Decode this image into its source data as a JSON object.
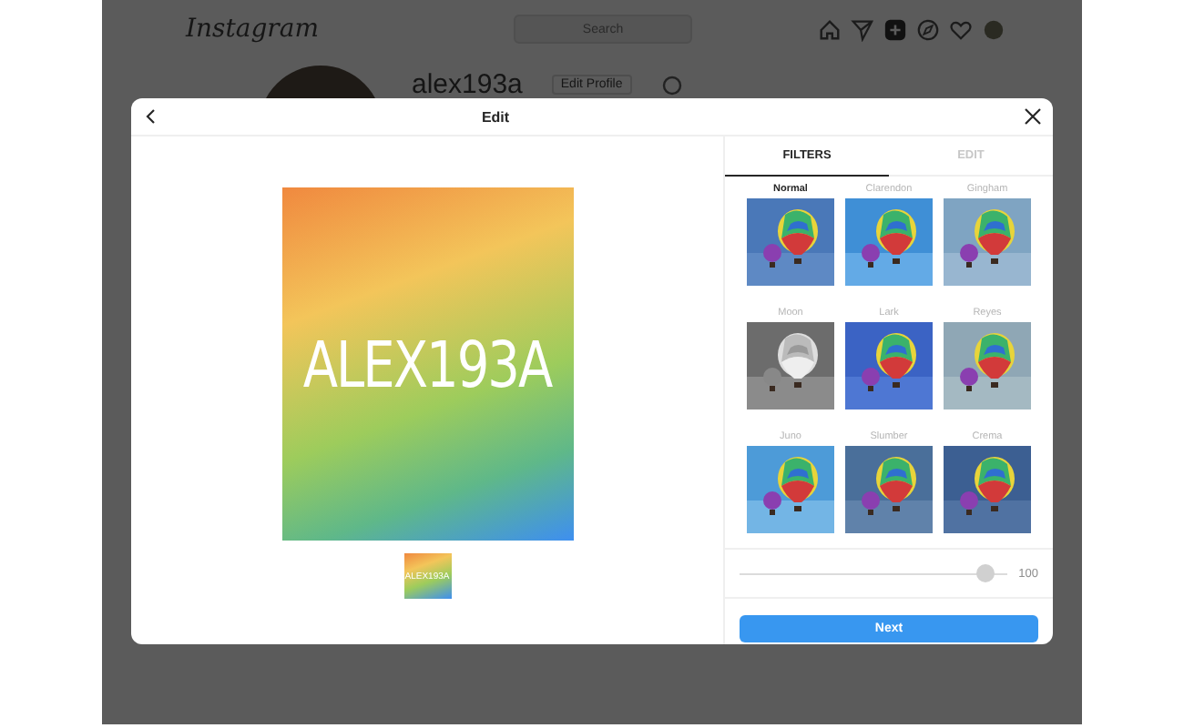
{
  "header": {
    "logo": "Instagram",
    "search": {
      "placeholder": "Search"
    }
  },
  "profile": {
    "username": "alex193a",
    "edit_button": "Edit Profile"
  },
  "modal": {
    "title": "Edit",
    "image_text": "ALEX193A",
    "thumbnail_text": "ALEX193A",
    "tabs": [
      {
        "label": "FILTERS",
        "selected": true
      },
      {
        "label": "EDIT",
        "selected": false
      }
    ],
    "filters": [
      {
        "name": "Normal",
        "selected": true
      },
      {
        "name": "Clarendon",
        "selected": false
      },
      {
        "name": "Gingham",
        "selected": false
      },
      {
        "name": "Moon",
        "selected": false
      },
      {
        "name": "Lark",
        "selected": false
      },
      {
        "name": "Reyes",
        "selected": false
      },
      {
        "name": "Juno",
        "selected": false
      },
      {
        "name": "Slumber",
        "selected": false
      },
      {
        "name": "Crema",
        "selected": false
      }
    ],
    "strength": {
      "level": 0.95,
      "reading": "100"
    },
    "next_button": "Next"
  }
}
